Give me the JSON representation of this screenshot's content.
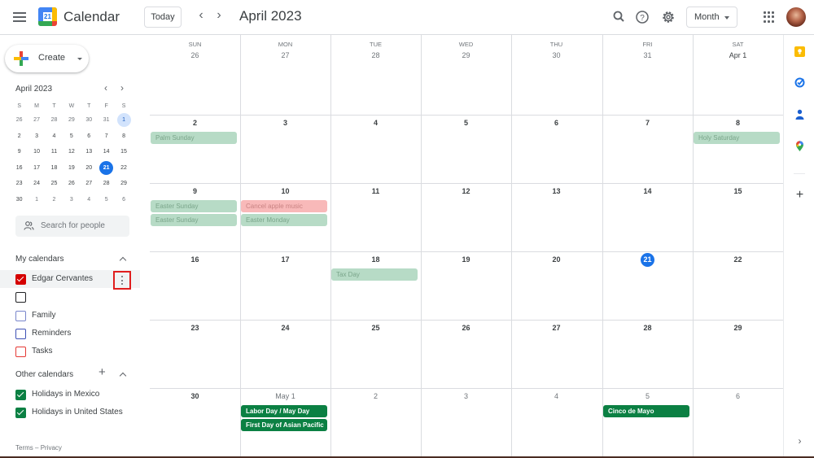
{
  "header": {
    "app_title": "Calendar",
    "logo_day": "21",
    "today_label": "Today",
    "month_title": "April 2023",
    "view_label": "Month",
    "icons": [
      "menu-icon",
      "search-icon",
      "help-icon",
      "settings-icon",
      "apps-icon",
      "avatar"
    ]
  },
  "sidebar": {
    "create_label": "Create",
    "mini_calendar": {
      "title": "April 2023",
      "weekdays": [
        "S",
        "M",
        "T",
        "W",
        "T",
        "F",
        "S"
      ],
      "weeks": [
        [
          "26",
          "27",
          "28",
          "29",
          "30",
          "31",
          "1"
        ],
        [
          "2",
          "3",
          "4",
          "5",
          "6",
          "7",
          "8"
        ],
        [
          "9",
          "10",
          "11",
          "12",
          "13",
          "14",
          "15"
        ],
        [
          "16",
          "17",
          "18",
          "19",
          "20",
          "21",
          "22"
        ],
        [
          "23",
          "24",
          "25",
          "26",
          "27",
          "28",
          "29"
        ],
        [
          "30",
          "1",
          "2",
          "3",
          "4",
          "5",
          "6"
        ]
      ],
      "selected": "1",
      "today": "21"
    },
    "search_placeholder": "Search for people",
    "my_calendars": {
      "title": "My calendars",
      "items": [
        {
          "label": "Edgar Cervantes",
          "checked": true,
          "color": "#d50000"
        },
        {
          "label": "",
          "checked": false,
          "color": "#202124"
        },
        {
          "label": "Family",
          "checked": false,
          "color": "#7986cb"
        },
        {
          "label": "Reminders",
          "checked": false,
          "color": "#3f51b5"
        },
        {
          "label": "Tasks",
          "checked": false,
          "color": "#e53935"
        }
      ]
    },
    "other_calendars": {
      "title": "Other calendars",
      "items": [
        {
          "label": "Holidays in Mexico",
          "checked": true,
          "color": "#0b8043"
        },
        {
          "label": "Holidays in United States",
          "checked": true,
          "color": "#0b8043"
        }
      ]
    },
    "footer": {
      "terms": "Terms",
      "sep": "–",
      "privacy": "Privacy"
    }
  },
  "month_grid": {
    "weekdays": [
      "SUN",
      "MON",
      "TUE",
      "WED",
      "THU",
      "FRI",
      "SAT"
    ],
    "weeks": [
      [
        "26",
        "27",
        "28",
        "29",
        "30",
        "31",
        "Apr 1"
      ],
      [
        "2",
        "3",
        "4",
        "5",
        "6",
        "7",
        "8"
      ],
      [
        "9",
        "10",
        "11",
        "12",
        "13",
        "14",
        "15"
      ],
      [
        "16",
        "17",
        "18",
        "19",
        "20",
        "21",
        "22"
      ],
      [
        "23",
        "24",
        "25",
        "26",
        "27",
        "28",
        "29"
      ],
      [
        "30",
        "May 1",
        "2",
        "3",
        "4",
        "5",
        "6"
      ]
    ],
    "today": "21",
    "events": [
      {
        "week": 1,
        "day": 0,
        "slot": 0,
        "title": "Palm Sunday",
        "style": "past-holiday"
      },
      {
        "week": 1,
        "day": 6,
        "slot": 0,
        "title": "Holy Saturday",
        "style": "past-holiday"
      },
      {
        "week": 2,
        "day": 0,
        "slot": 0,
        "title": "Easter Sunday",
        "style": "past-holiday"
      },
      {
        "week": 2,
        "day": 0,
        "slot": 1,
        "title": "Easter Sunday",
        "style": "past-holiday"
      },
      {
        "week": 2,
        "day": 1,
        "slot": 0,
        "title": "Cancel apple music",
        "style": "past-personal"
      },
      {
        "week": 2,
        "day": 1,
        "slot": 1,
        "title": "Easter Monday",
        "style": "past-holiday"
      },
      {
        "week": 3,
        "day": 2,
        "slot": 0,
        "title": "Tax Day",
        "style": "past-holiday"
      },
      {
        "week": 5,
        "day": 1,
        "slot": 0,
        "title": "Labor Day / May Day",
        "style": "holiday"
      },
      {
        "week": 5,
        "day": 1,
        "slot": 1,
        "title": "First Day of Asian Pacific",
        "style": "holiday"
      },
      {
        "week": 5,
        "day": 5,
        "slot": 0,
        "title": "Cinco de Mayo",
        "style": "holiday"
      }
    ]
  },
  "right_panel": {
    "icons": [
      "keep-icon",
      "tasks-icon",
      "contacts-icon",
      "maps-icon",
      "add-addon-icon",
      "expand-panel-icon"
    ]
  },
  "colors": {
    "accent": "#1a73e8",
    "holiday_green": "#0b8043",
    "past_holiday": "#b7dbc6",
    "past_personal": "#f8b9b9",
    "highlight_box": "#e01e1e"
  }
}
